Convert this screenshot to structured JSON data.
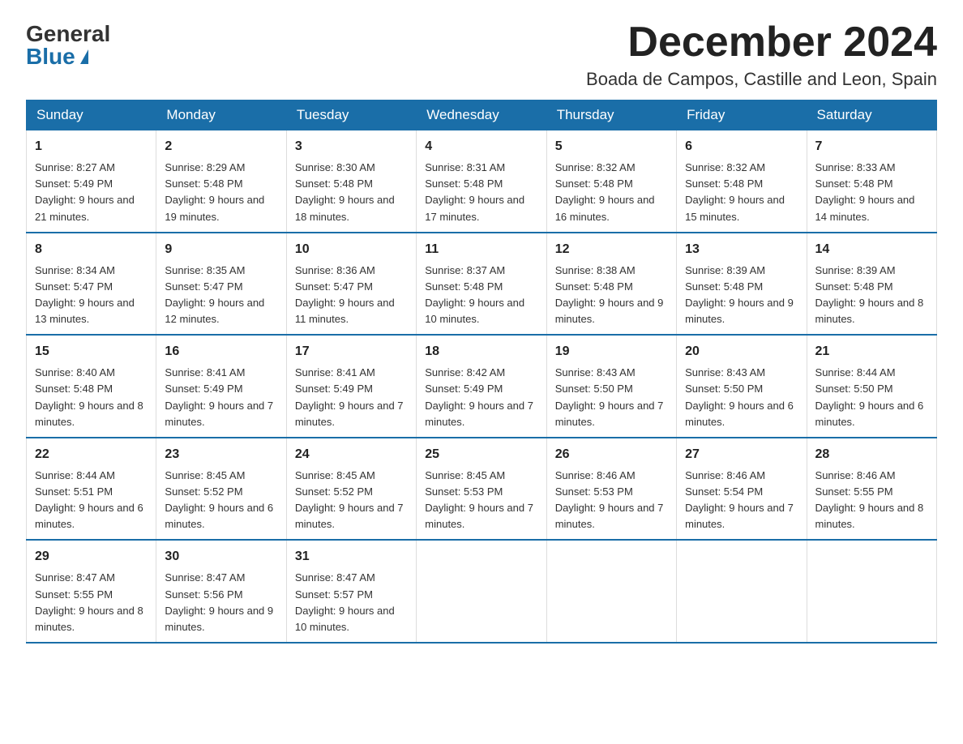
{
  "logo": {
    "general": "General",
    "blue": "Blue"
  },
  "title": {
    "month_year": "December 2024",
    "location": "Boada de Campos, Castille and Leon, Spain"
  },
  "header": {
    "days": [
      "Sunday",
      "Monday",
      "Tuesday",
      "Wednesday",
      "Thursday",
      "Friday",
      "Saturday"
    ]
  },
  "weeks": [
    [
      {
        "num": "1",
        "sunrise": "Sunrise: 8:27 AM",
        "sunset": "Sunset: 5:49 PM",
        "daylight": "Daylight: 9 hours and 21 minutes."
      },
      {
        "num": "2",
        "sunrise": "Sunrise: 8:29 AM",
        "sunset": "Sunset: 5:48 PM",
        "daylight": "Daylight: 9 hours and 19 minutes."
      },
      {
        "num": "3",
        "sunrise": "Sunrise: 8:30 AM",
        "sunset": "Sunset: 5:48 PM",
        "daylight": "Daylight: 9 hours and 18 minutes."
      },
      {
        "num": "4",
        "sunrise": "Sunrise: 8:31 AM",
        "sunset": "Sunset: 5:48 PM",
        "daylight": "Daylight: 9 hours and 17 minutes."
      },
      {
        "num": "5",
        "sunrise": "Sunrise: 8:32 AM",
        "sunset": "Sunset: 5:48 PM",
        "daylight": "Daylight: 9 hours and 16 minutes."
      },
      {
        "num": "6",
        "sunrise": "Sunrise: 8:32 AM",
        "sunset": "Sunset: 5:48 PM",
        "daylight": "Daylight: 9 hours and 15 minutes."
      },
      {
        "num": "7",
        "sunrise": "Sunrise: 8:33 AM",
        "sunset": "Sunset: 5:48 PM",
        "daylight": "Daylight: 9 hours and 14 minutes."
      }
    ],
    [
      {
        "num": "8",
        "sunrise": "Sunrise: 8:34 AM",
        "sunset": "Sunset: 5:47 PM",
        "daylight": "Daylight: 9 hours and 13 minutes."
      },
      {
        "num": "9",
        "sunrise": "Sunrise: 8:35 AM",
        "sunset": "Sunset: 5:47 PM",
        "daylight": "Daylight: 9 hours and 12 minutes."
      },
      {
        "num": "10",
        "sunrise": "Sunrise: 8:36 AM",
        "sunset": "Sunset: 5:47 PM",
        "daylight": "Daylight: 9 hours and 11 minutes."
      },
      {
        "num": "11",
        "sunrise": "Sunrise: 8:37 AM",
        "sunset": "Sunset: 5:48 PM",
        "daylight": "Daylight: 9 hours and 10 minutes."
      },
      {
        "num": "12",
        "sunrise": "Sunrise: 8:38 AM",
        "sunset": "Sunset: 5:48 PM",
        "daylight": "Daylight: 9 hours and 9 minutes."
      },
      {
        "num": "13",
        "sunrise": "Sunrise: 8:39 AM",
        "sunset": "Sunset: 5:48 PM",
        "daylight": "Daylight: 9 hours and 9 minutes."
      },
      {
        "num": "14",
        "sunrise": "Sunrise: 8:39 AM",
        "sunset": "Sunset: 5:48 PM",
        "daylight": "Daylight: 9 hours and 8 minutes."
      }
    ],
    [
      {
        "num": "15",
        "sunrise": "Sunrise: 8:40 AM",
        "sunset": "Sunset: 5:48 PM",
        "daylight": "Daylight: 9 hours and 8 minutes."
      },
      {
        "num": "16",
        "sunrise": "Sunrise: 8:41 AM",
        "sunset": "Sunset: 5:49 PM",
        "daylight": "Daylight: 9 hours and 7 minutes."
      },
      {
        "num": "17",
        "sunrise": "Sunrise: 8:41 AM",
        "sunset": "Sunset: 5:49 PM",
        "daylight": "Daylight: 9 hours and 7 minutes."
      },
      {
        "num": "18",
        "sunrise": "Sunrise: 8:42 AM",
        "sunset": "Sunset: 5:49 PM",
        "daylight": "Daylight: 9 hours and 7 minutes."
      },
      {
        "num": "19",
        "sunrise": "Sunrise: 8:43 AM",
        "sunset": "Sunset: 5:50 PM",
        "daylight": "Daylight: 9 hours and 7 minutes."
      },
      {
        "num": "20",
        "sunrise": "Sunrise: 8:43 AM",
        "sunset": "Sunset: 5:50 PM",
        "daylight": "Daylight: 9 hours and 6 minutes."
      },
      {
        "num": "21",
        "sunrise": "Sunrise: 8:44 AM",
        "sunset": "Sunset: 5:50 PM",
        "daylight": "Daylight: 9 hours and 6 minutes."
      }
    ],
    [
      {
        "num": "22",
        "sunrise": "Sunrise: 8:44 AM",
        "sunset": "Sunset: 5:51 PM",
        "daylight": "Daylight: 9 hours and 6 minutes."
      },
      {
        "num": "23",
        "sunrise": "Sunrise: 8:45 AM",
        "sunset": "Sunset: 5:52 PM",
        "daylight": "Daylight: 9 hours and 6 minutes."
      },
      {
        "num": "24",
        "sunrise": "Sunrise: 8:45 AM",
        "sunset": "Sunset: 5:52 PM",
        "daylight": "Daylight: 9 hours and 7 minutes."
      },
      {
        "num": "25",
        "sunrise": "Sunrise: 8:45 AM",
        "sunset": "Sunset: 5:53 PM",
        "daylight": "Daylight: 9 hours and 7 minutes."
      },
      {
        "num": "26",
        "sunrise": "Sunrise: 8:46 AM",
        "sunset": "Sunset: 5:53 PM",
        "daylight": "Daylight: 9 hours and 7 minutes."
      },
      {
        "num": "27",
        "sunrise": "Sunrise: 8:46 AM",
        "sunset": "Sunset: 5:54 PM",
        "daylight": "Daylight: 9 hours and 7 minutes."
      },
      {
        "num": "28",
        "sunrise": "Sunrise: 8:46 AM",
        "sunset": "Sunset: 5:55 PM",
        "daylight": "Daylight: 9 hours and 8 minutes."
      }
    ],
    [
      {
        "num": "29",
        "sunrise": "Sunrise: 8:47 AM",
        "sunset": "Sunset: 5:55 PM",
        "daylight": "Daylight: 9 hours and 8 minutes."
      },
      {
        "num": "30",
        "sunrise": "Sunrise: 8:47 AM",
        "sunset": "Sunset: 5:56 PM",
        "daylight": "Daylight: 9 hours and 9 minutes."
      },
      {
        "num": "31",
        "sunrise": "Sunrise: 8:47 AM",
        "sunset": "Sunset: 5:57 PM",
        "daylight": "Daylight: 9 hours and 10 minutes."
      },
      null,
      null,
      null,
      null
    ]
  ]
}
